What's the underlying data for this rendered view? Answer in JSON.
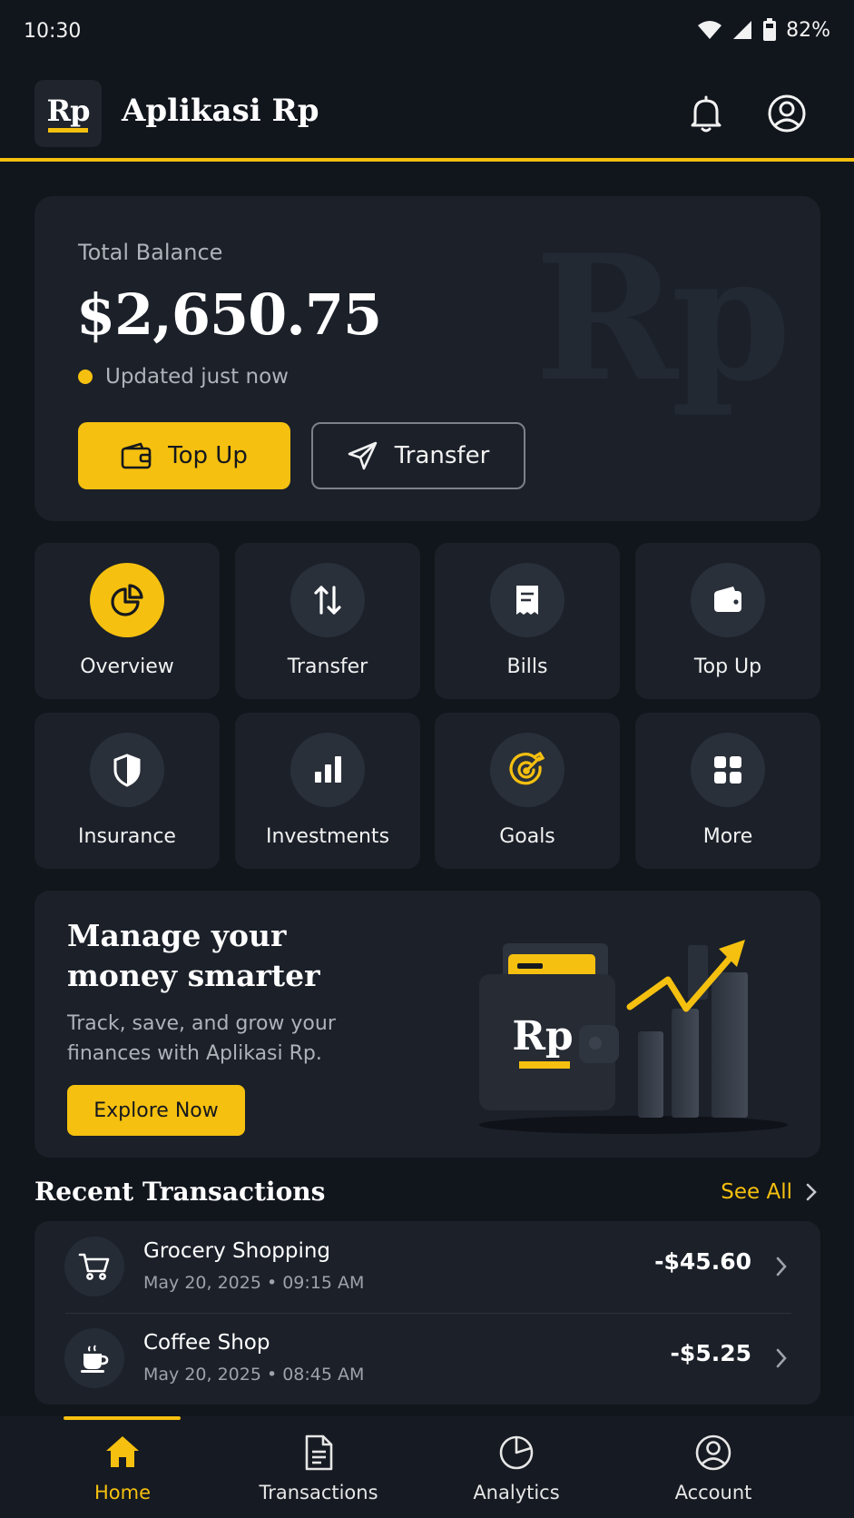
{
  "status_bar": {
    "time": "10:30",
    "battery_percent": "82%",
    "icons": [
      "wifi-icon",
      "signal-icon",
      "battery-icon"
    ]
  },
  "app_bar": {
    "logo_text": "Rp",
    "title": "Aplikasi Rp",
    "actions": [
      "bell-icon",
      "profile-icon"
    ]
  },
  "balance_card": {
    "label": "Total Balance",
    "amount": "$2,650.75",
    "updated_text": "Updated just now",
    "watermark": "Rp",
    "primary_button": {
      "label": "Top Up",
      "icon": "wallet-icon"
    },
    "secondary_button": {
      "label": "Transfer",
      "icon": "send-icon"
    }
  },
  "quick_actions": [
    {
      "label": "Overview",
      "icon": "pie-chart-icon",
      "active": true
    },
    {
      "label": "Transfer",
      "icon": "arrows-up-down-icon",
      "active": false
    },
    {
      "label": "Bills",
      "icon": "receipt-icon",
      "active": false
    },
    {
      "label": "Top Up",
      "icon": "wallet-icon",
      "active": false
    },
    {
      "label": "Insurance",
      "icon": "shield-icon",
      "active": false
    },
    {
      "label": "Investments",
      "icon": "bar-chart-icon",
      "active": false
    },
    {
      "label": "Goals",
      "icon": "target-icon",
      "active": false
    },
    {
      "label": "More",
      "icon": "grid-icon",
      "active": false
    }
  ],
  "promo": {
    "title": "Manage your money smarter",
    "subtitle": "Track, save, and grow your finances with Aplikasi Rp.",
    "button_label": "Explore Now",
    "art_logo_text": "Rp"
  },
  "recent_transactions": {
    "title": "Recent Transactions",
    "see_all_label": "See All",
    "items": [
      {
        "name": "Grocery Shopping",
        "date": "May 20, 2025 • 09:15 AM",
        "amount": "-$45.60",
        "icon": "cart-icon"
      },
      {
        "name": "Coffee Shop",
        "date": "May 20, 2025 • 08:45 AM",
        "amount": "-$5.25",
        "icon": "coffee-cup-icon"
      }
    ]
  },
  "bottom_nav": {
    "items": [
      {
        "label": "Home",
        "icon": "home-icon",
        "active": true
      },
      {
        "label": "Transactions",
        "icon": "document-icon",
        "active": false
      },
      {
        "label": "Analytics",
        "icon": "pie-chart-icon",
        "active": false
      },
      {
        "label": "Account",
        "icon": "account-icon",
        "active": false
      }
    ]
  },
  "colors": {
    "background": "#11151c",
    "card": "#1b2029",
    "accent": "#f5c00f",
    "text_primary": "#ffffff",
    "text_secondary": "#aeb2b9"
  }
}
